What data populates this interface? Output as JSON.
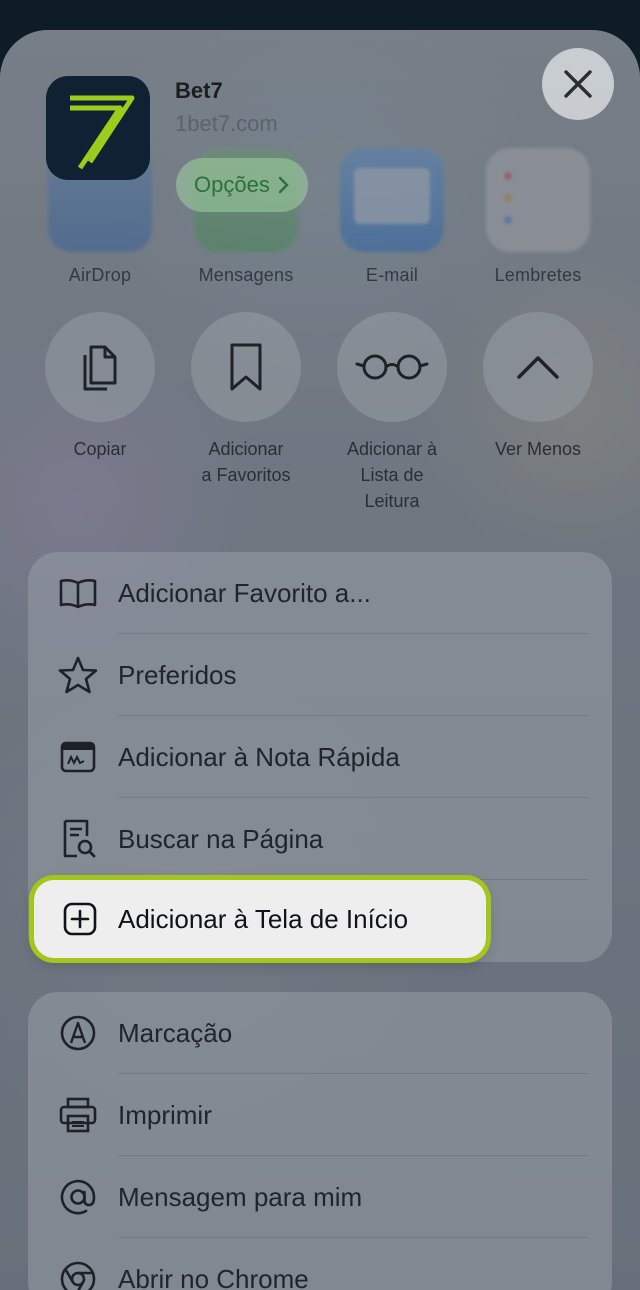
{
  "app": {
    "name": "Bet7",
    "url": "1bet7.com",
    "options_label": "Opções",
    "icon": "bet7-logo"
  },
  "share_targets": [
    {
      "label": "AirDrop",
      "icon": "airdrop-icon"
    },
    {
      "label": "Mensagens",
      "icon": "messages-icon"
    },
    {
      "label": "E-mail",
      "icon": "mail-icon"
    },
    {
      "label": "Lembretes",
      "icon": "reminders-icon"
    }
  ],
  "actions": [
    {
      "label": "Copiar",
      "icon": "copy-icon"
    },
    {
      "label": "Adicionar\na Favoritos",
      "icon": "bookmark-icon"
    },
    {
      "label": "Adicionar à\nLista de\nLeitura",
      "icon": "reading-glasses-icon"
    },
    {
      "label": "Ver Menos",
      "icon": "chevron-up-icon"
    }
  ],
  "menu_group_1": [
    {
      "label": "Adicionar Favorito a...",
      "icon": "book-icon"
    },
    {
      "label": "Preferidos",
      "icon": "star-icon"
    },
    {
      "label": "Adicionar à Nota Rápida",
      "icon": "quick-note-icon"
    },
    {
      "label": "Buscar na Página",
      "icon": "find-in-page-icon"
    }
  ],
  "highlighted_item": {
    "label": "Adicionar à Tela de Início",
    "icon": "plus-square-icon"
  },
  "menu_group_2": [
    {
      "label": "Marcação",
      "icon": "markup-icon"
    },
    {
      "label": "Imprimir",
      "icon": "printer-icon"
    },
    {
      "label": "Mensagem para mim",
      "icon": "at-icon"
    },
    {
      "label": "Abrir no Chrome",
      "icon": "chrome-icon"
    }
  ],
  "colors": {
    "highlight_border": "#a4c51a",
    "brand_green": "#9ccc1c",
    "app_bg": "#0f2233"
  }
}
